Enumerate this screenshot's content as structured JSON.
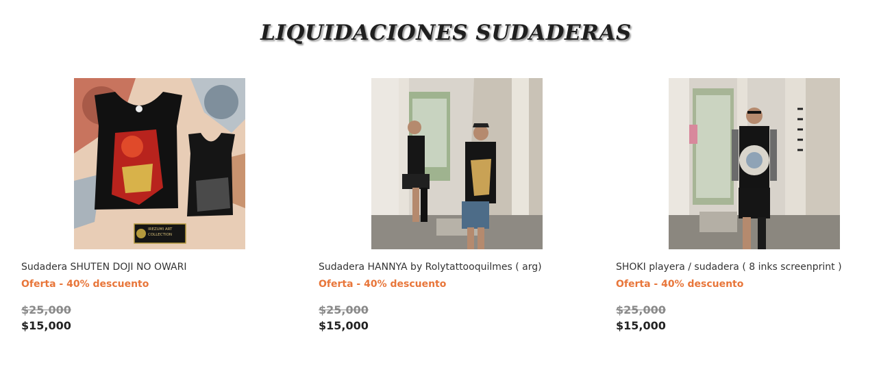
{
  "section": {
    "title": "LIQUIDACIONES SUDADERAS"
  },
  "colors": {
    "offer": "#e8763a",
    "old_price": "#8a8a8a",
    "price": "#222222"
  },
  "products": [
    {
      "name": "Sudadera SHUTEN DOJI NO OWARI",
      "offer": "Oferta - 40% descuento",
      "old_price": "$25,000",
      "price": "$15,000",
      "image_icon": "tank-top-artwork-image",
      "logo_text": "IREZUMI ART COLLECTION"
    },
    {
      "name": "Sudadera HANNYA by Rolytattooquilmes ( arg)",
      "offer": "Oferta - 40% descuento",
      "old_price": "$25,000",
      "price": "$15,000",
      "image_icon": "models-photo-image"
    },
    {
      "name": "SHOKI playera / sudadera ( 8 inks screenprint )",
      "offer": "Oferta - 40% descuento",
      "old_price": "$25,000",
      "price": "$15,000",
      "image_icon": "model-photo-image"
    }
  ]
}
